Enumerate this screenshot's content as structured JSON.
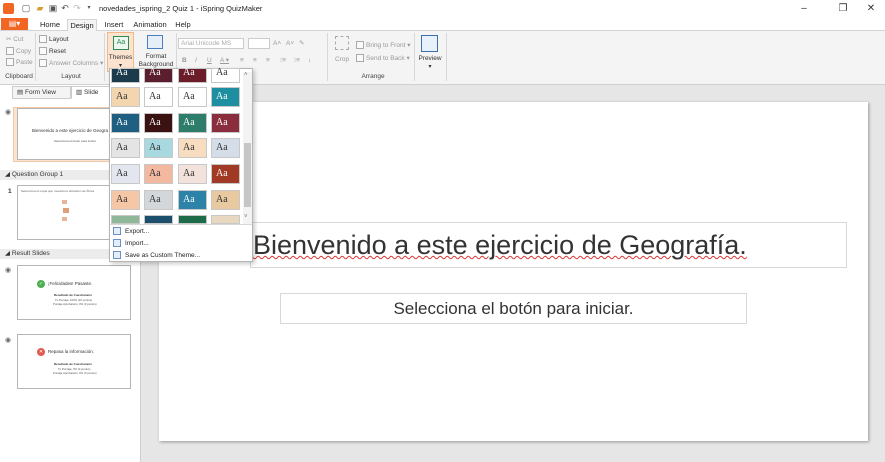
{
  "app": {
    "title": "novedades_ispring_2 Quiz 1 - iSpring QuizMaker"
  },
  "tabs": [
    {
      "label": "Home"
    },
    {
      "label": "Design"
    },
    {
      "label": "Insert"
    },
    {
      "label": "Animation"
    },
    {
      "label": "Help"
    }
  ],
  "ribbon": {
    "clipboard": {
      "cut": "Cut",
      "copy": "Copy",
      "paste": "Paste",
      "label": "Clipboard"
    },
    "layout": {
      "layout": "Layout",
      "reset": "Reset",
      "answer_columns": "Answer Columns",
      "label": "Layout"
    },
    "themes": {
      "label": "Themes"
    },
    "format_background": {
      "line1": "Format",
      "line2": "Background"
    },
    "font": {
      "family": "Arial Unicode MS",
      "bold": "B",
      "italic": "I",
      "underline": "U"
    },
    "arrange": {
      "crop": "Crop",
      "bring_to_front": "Bring to Front",
      "send_to_back": "Send to Back",
      "label": "Arrange"
    },
    "preview": {
      "label": "Preview"
    }
  },
  "left_panel": {
    "view_tabs": {
      "form": "Form View",
      "slide": "Slide"
    },
    "slides": [
      {
        "title": "Bienvenido a este ejercicio de Geogra",
        "subtitle": "Selecciona el botón para iniciar."
      }
    ],
    "group1": {
      "header": "Question Group 1",
      "number": "1",
      "text": "Selecciona el mapa que muestra la ubicación de África"
    },
    "results": {
      "header": "Result Slides",
      "passed": {
        "title": "¡Felicidades! Pasaste.",
        "heading": "Resultado de Cuestionario",
        "line1": "Tu Puntaje: 100% (10 puntos)",
        "line2": "Puntaje Aprobatorio: 0% (0 puntos)"
      },
      "failed": {
        "title": "Repasa la información.",
        "heading": "Resultado de Cuestionario",
        "line1": "Tu Puntaje: 0% (0 puntos)",
        "line2": "Puntaje Aprobatorio: 0% (0 puntos)"
      }
    }
  },
  "slide": {
    "title": "Bienvenido a este ejercicio de Geografía.",
    "subtitle": "Selecciona el botón para iniciar."
  },
  "theme_dropdown": {
    "swatch_label": "Aa",
    "rows": [
      [
        {
          "bg": "#1b3a4b",
          "fg": "#ffffff"
        },
        {
          "bg": "#5a1e2e",
          "fg": "#ffffff"
        },
        {
          "bg": "#6b1d2a",
          "fg": "#ffffff"
        },
        {
          "bg": "#ffffff",
          "fg": "#333333"
        }
      ],
      [
        {
          "bg": "#f3d6b0",
          "fg": "#333333"
        },
        {
          "bg": "#ffffff",
          "fg": "#333333"
        },
        {
          "bg": "#ffffff",
          "fg": "#333333"
        },
        {
          "bg": "#1e8fa0",
          "fg": "#ffffff"
        }
      ],
      [
        {
          "bg": "#1e5f82",
          "fg": "#ffffff"
        },
        {
          "bg": "#3b1212",
          "fg": "#ffffff"
        },
        {
          "bg": "#2e7d6b",
          "fg": "#ffffff"
        },
        {
          "bg": "#8a2e3e",
          "fg": "#ffffff"
        }
      ],
      [
        {
          "bg": "#e4e4e4",
          "fg": "#333333"
        },
        {
          "bg": "#a8d8e0",
          "fg": "#333333"
        },
        {
          "bg": "#f7dcc0",
          "fg": "#333333"
        },
        {
          "bg": "#d5dde8",
          "fg": "#333333"
        }
      ],
      [
        {
          "bg": "#e3e6ef",
          "fg": "#333333"
        },
        {
          "bg": "#f2b8a0",
          "fg": "#333333"
        },
        {
          "bg": "#f3e1dc",
          "fg": "#333333"
        },
        {
          "bg": "#a03a24",
          "fg": "#ffffff"
        }
      ],
      [
        {
          "bg": "#f6c7a6",
          "fg": "#333333"
        },
        {
          "bg": "#d4d7da",
          "fg": "#333333"
        },
        {
          "bg": "#2d82a8",
          "fg": "#ffffff"
        },
        {
          "bg": "#e8c9a0",
          "fg": "#333333"
        }
      ]
    ],
    "menu": [
      {
        "label": "Export..."
      },
      {
        "label": "Import..."
      },
      {
        "label": "Save as Custom Theme..."
      }
    ]
  },
  "colors": {
    "accent": "#f26522"
  }
}
